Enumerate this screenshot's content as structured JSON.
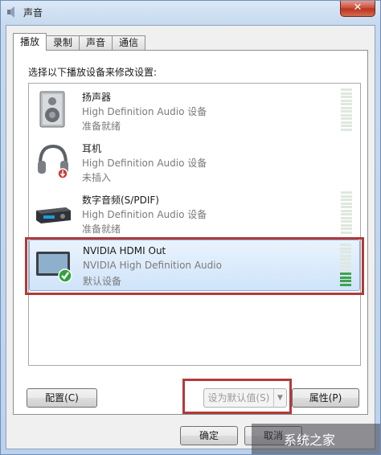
{
  "window": {
    "title": "声音",
    "close_glyph": "✕"
  },
  "tabs": [
    {
      "label": "播放",
      "active": true
    },
    {
      "label": "录制",
      "active": false
    },
    {
      "label": "声音",
      "active": false
    },
    {
      "label": "通信",
      "active": false
    }
  ],
  "instruction": "选择以下播放设备来修改设置:",
  "devices": [
    {
      "name": "扬声器",
      "description": "High Definition Audio 设备",
      "status": "准备就绪",
      "icon": "speaker-icon",
      "meter_level": 0
    },
    {
      "name": "耳机",
      "description": "High Definition Audio 设备",
      "status": "未插入",
      "icon": "headphones-icon",
      "meter_level": 0
    },
    {
      "name": "数字音频(S/PDIF)",
      "description": "High Definition Audio 设备",
      "status": "准备就绪",
      "icon": "digital-audio-icon",
      "meter_level": 0
    },
    {
      "name": "NVIDIA HDMI Out",
      "description": "NVIDIA High Definition Audio",
      "status": "默认设备",
      "icon": "monitor-icon",
      "meter_level": 0.3,
      "selected": true
    }
  ],
  "buttons": {
    "configure": "配置(C)",
    "set_default": "设为默认值(S)",
    "properties": "属性(P)",
    "ok": "确定",
    "cancel": "取消"
  },
  "watermark": "系统之家",
  "colors": {
    "highlight_box": "#b23a3a",
    "meter_on": "#3fa34d",
    "meter_off": "#dfe8df",
    "selection": "#cfe4fa"
  }
}
